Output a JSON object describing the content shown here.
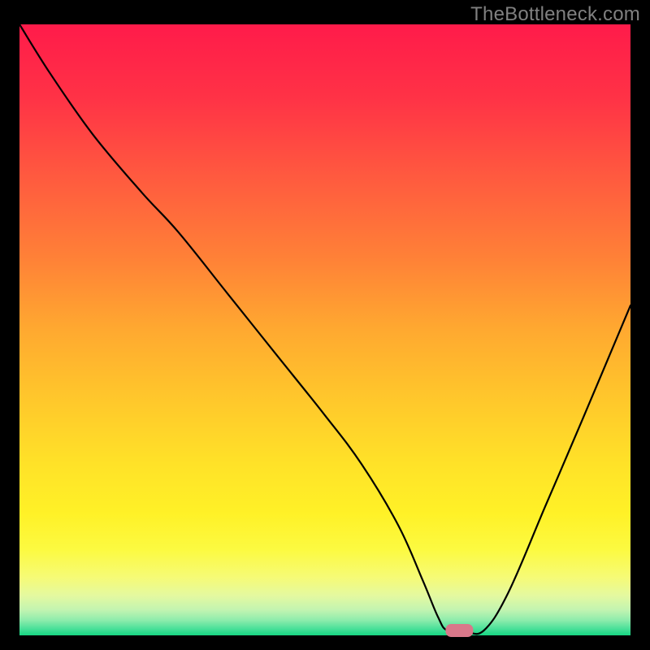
{
  "watermark": "TheBottleneck.com",
  "gradient": {
    "stops": [
      {
        "offset": 0.0,
        "color": "#ff1b4a"
      },
      {
        "offset": 0.12,
        "color": "#ff3246"
      },
      {
        "offset": 0.25,
        "color": "#ff5a3f"
      },
      {
        "offset": 0.38,
        "color": "#ff8037"
      },
      {
        "offset": 0.5,
        "color": "#ffa930"
      },
      {
        "offset": 0.62,
        "color": "#ffc92b"
      },
      {
        "offset": 0.72,
        "color": "#ffe228"
      },
      {
        "offset": 0.8,
        "color": "#fff127"
      },
      {
        "offset": 0.86,
        "color": "#fcfa41"
      },
      {
        "offset": 0.905,
        "color": "#f6fb76"
      },
      {
        "offset": 0.935,
        "color": "#e4f9a0"
      },
      {
        "offset": 0.958,
        "color": "#c3f4b1"
      },
      {
        "offset": 0.975,
        "color": "#8eecac"
      },
      {
        "offset": 0.988,
        "color": "#4fe19b"
      },
      {
        "offset": 1.0,
        "color": "#16d683"
      }
    ]
  },
  "chart_data": {
    "type": "line",
    "title": "",
    "xlabel": "",
    "ylabel": "",
    "xlim": [
      0,
      100
    ],
    "ylim": [
      0,
      100
    ],
    "series": [
      {
        "name": "bottleneck-curve",
        "x": [
          0,
          5,
          12,
          20,
          26,
          34,
          42,
          50,
          56,
          62,
          66,
          68.5,
          70,
          73,
          76,
          80,
          86,
          92,
          100
        ],
        "y": [
          100,
          92,
          82,
          72.5,
          66,
          56,
          46,
          36,
          28,
          18,
          9,
          3,
          0.8,
          0.6,
          0.8,
          7,
          21,
          35,
          54
        ]
      }
    ],
    "marker": {
      "x": 72,
      "y": 0.8,
      "label": "optimal-point"
    }
  }
}
